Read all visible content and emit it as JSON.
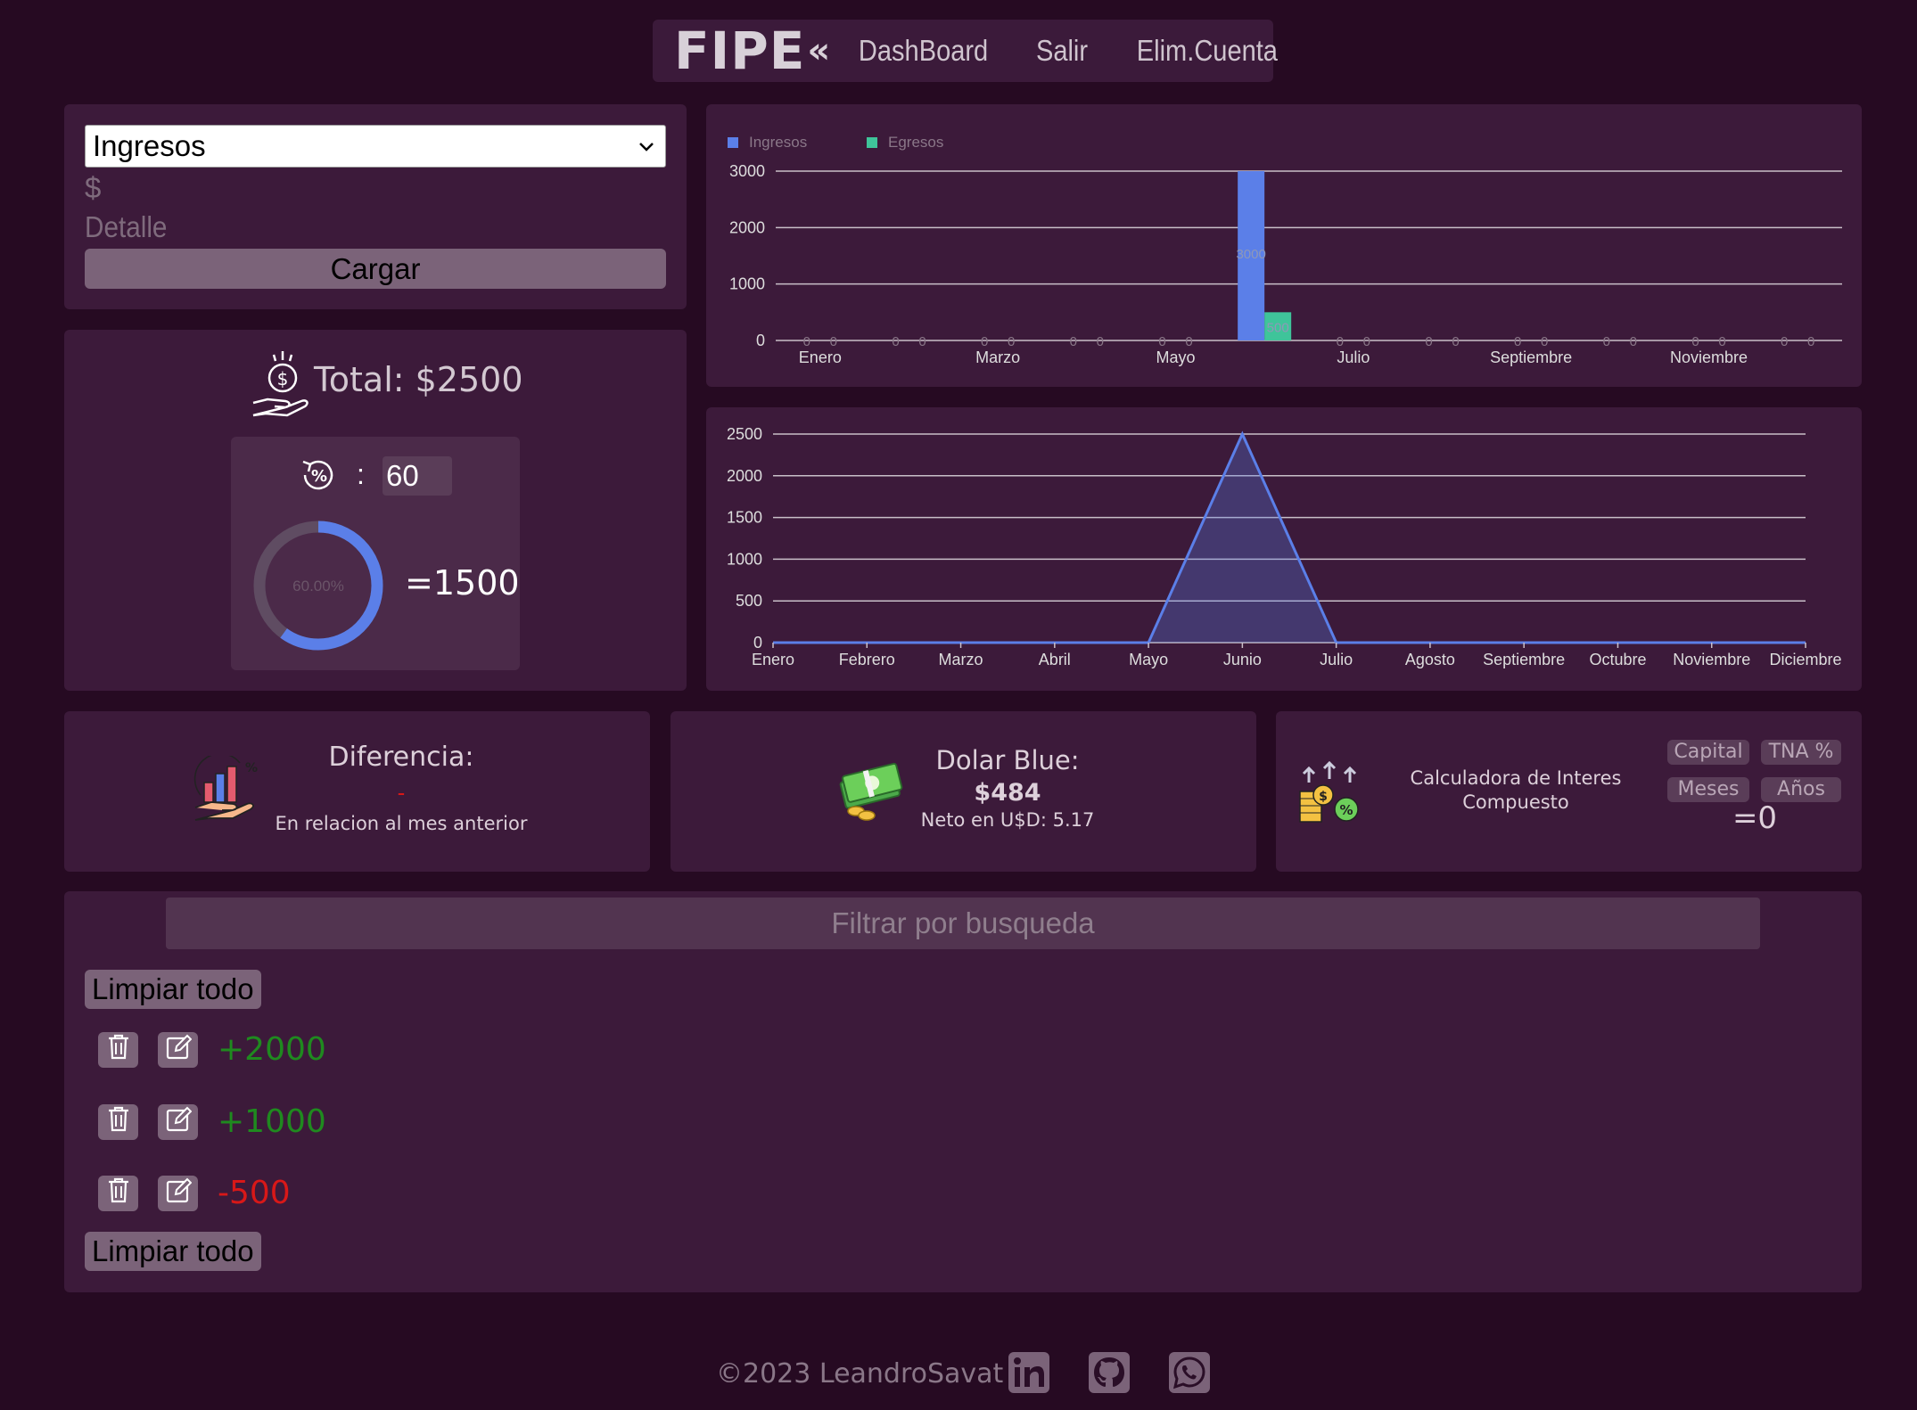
{
  "nav": {
    "logo": "FIPE",
    "logo_mark": "«",
    "links": [
      "DashBoard",
      "Salir",
      "Elim.Cuenta"
    ]
  },
  "form": {
    "type_selected": "Ingresos",
    "amount_placeholder": "$",
    "detail_placeholder": "Detalle",
    "submit_label": "Cargar"
  },
  "total": {
    "label": "Total: $2500",
    "percent_sep": ":",
    "percent_value": "60",
    "donut_label": "60.00%",
    "donut_fraction": 0.6,
    "result": "=1500"
  },
  "colors": {
    "ingresos": "#5b7fe8",
    "egresos": "#3fc49a",
    "positive": "#1f8a1f",
    "negative": "#d81818"
  },
  "chart_data": [
    {
      "type": "bar",
      "legend": [
        "Ingresos",
        "Egresos"
      ],
      "legend_position": "top-left",
      "categories": [
        "Enero",
        "Febrero",
        "Marzo",
        "Abril",
        "Mayo",
        "Junio",
        "Julio",
        "Agosto",
        "Septiembre",
        "Octubre",
        "Noviembre",
        "Diciembre"
      ],
      "x_tick_labels": [
        "Enero",
        "Marzo",
        "Mayo",
        "Julio",
        "Septiembre",
        "Noviembre"
      ],
      "series": [
        {
          "name": "Ingresos",
          "values": [
            0,
            0,
            0,
            0,
            0,
            3000,
            0,
            0,
            0,
            0,
            0,
            0
          ]
        },
        {
          "name": "Egresos",
          "values": [
            0,
            0,
            0,
            0,
            0,
            500,
            0,
            0,
            0,
            0,
            0,
            0
          ]
        }
      ],
      "data_labels": [
        "3000",
        "500",
        "0"
      ],
      "ylim": [
        0,
        3000
      ],
      "yticks": [
        "3000",
        "2000",
        "1000",
        "0"
      ],
      "grid": true
    },
    {
      "type": "area",
      "categories": [
        "Enero",
        "Febrero",
        "Marzo",
        "Abril",
        "Mayo",
        "Junio",
        "Julio",
        "Agosto",
        "Septiembre",
        "Octubre",
        "Noviembre",
        "Diciembre"
      ],
      "values": [
        0,
        0,
        0,
        0,
        0,
        2500,
        0,
        0,
        0,
        0,
        0,
        0
      ],
      "ylim": [
        0,
        2500
      ],
      "yticks": [
        "2500",
        "2000",
        "1500",
        "1000",
        "500",
        "0"
      ],
      "grid": true
    }
  ],
  "diferencia": {
    "title": "Diferencia:",
    "value": "-",
    "subtitle": "En relacion al mes anterior"
  },
  "dolar": {
    "title": "Dolar Blue:",
    "value": "$484",
    "neto": "Neto en U$D: 5.17"
  },
  "calculadora": {
    "title": "Calculadora de Interes Compuesto",
    "capital": "Capital",
    "tna": "TNA %",
    "meses": "Meses",
    "anios": "Años",
    "result": "=0"
  },
  "search": {
    "placeholder": "Filtrar por busqueda"
  },
  "list": {
    "clear_label": "Limpiar todo",
    "items": [
      "+2000",
      "+1000",
      "-500"
    ]
  },
  "footer": {
    "copyright": "©2023 LeandroSavat",
    "icons": [
      "linkedin-icon",
      "github-icon",
      "whatsapp-icon"
    ]
  }
}
